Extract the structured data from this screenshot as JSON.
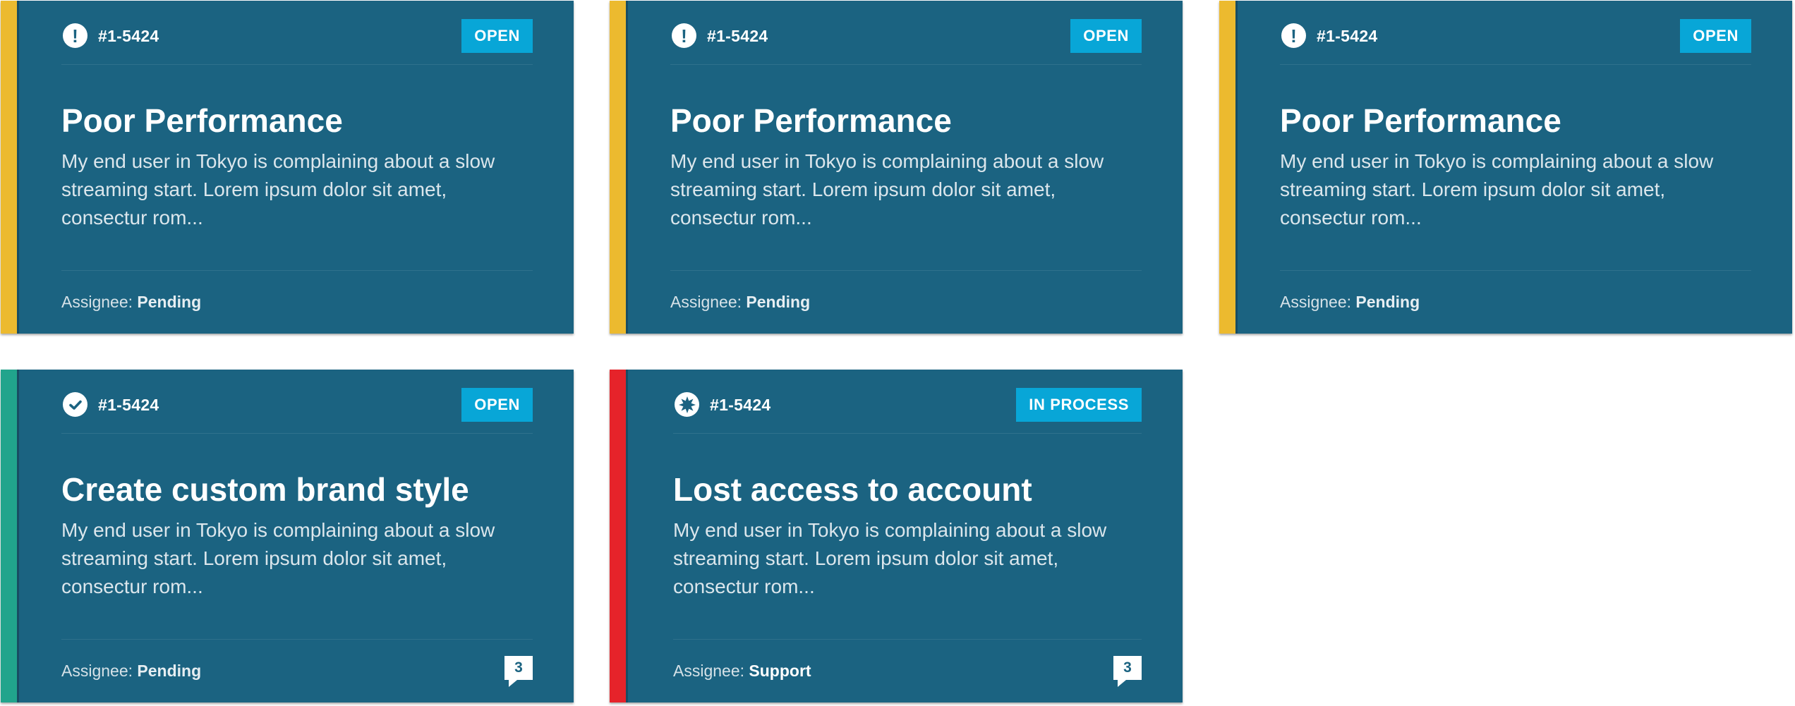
{
  "colors": {
    "card_bg": "#1b6381",
    "badge_bg": "#08a6d7",
    "stripe_warning": "#ecba2f",
    "stripe_success": "#21a48c",
    "stripe_critical": "#e6232a"
  },
  "cards": [
    {
      "icon": "exclamation-icon",
      "id": "#1-5424",
      "status": "OPEN",
      "title": "Poor Performance",
      "description": "My end user in Tokyo is complaining about a slow streaming start. Lorem ipsum dolor sit amet, consectur rom...",
      "assignee_label": "Assignee:",
      "assignee_value": "Pending",
      "stripe_color": "#ecba2f"
    },
    {
      "icon": "exclamation-icon",
      "id": "#1-5424",
      "status": "OPEN",
      "title": "Poor Performance",
      "description": "My end user in Tokyo is complaining about a slow streaming start. Lorem ipsum dolor sit amet, consectur rom...",
      "assignee_label": "Assignee:",
      "assignee_value": "Pending",
      "stripe_color": "#ecba2f"
    },
    {
      "icon": "exclamation-icon",
      "id": "#1-5424",
      "status": "OPEN",
      "title": "Poor Performance",
      "description": "My end user in Tokyo is complaining about a slow streaming start. Lorem ipsum dolor sit amet, consectur rom...",
      "assignee_label": "Assignee:",
      "assignee_value": "Pending",
      "stripe_color": "#ecba2f"
    },
    {
      "icon": "check-icon",
      "id": "#1-5424",
      "status": "OPEN",
      "title": "Create custom brand style",
      "description": "My end user in Tokyo is complaining about a slow streaming start. Lorem ipsum dolor sit amet, consectur rom...",
      "assignee_label": "Assignee:",
      "assignee_value": "Pending",
      "comment_count": "3",
      "stripe_color": "#21a48c"
    },
    {
      "icon": "burst-icon",
      "id": "#1-5424",
      "status": "IN PROCESS",
      "title": "Lost access to account",
      "description": "My end user in Tokyo is complaining about a slow streaming start. Lorem ipsum dolor sit amet, consectur rom...",
      "assignee_label": "Assignee:",
      "assignee_value": "Support",
      "comment_count": "3",
      "stripe_color": "#e6232a"
    }
  ]
}
